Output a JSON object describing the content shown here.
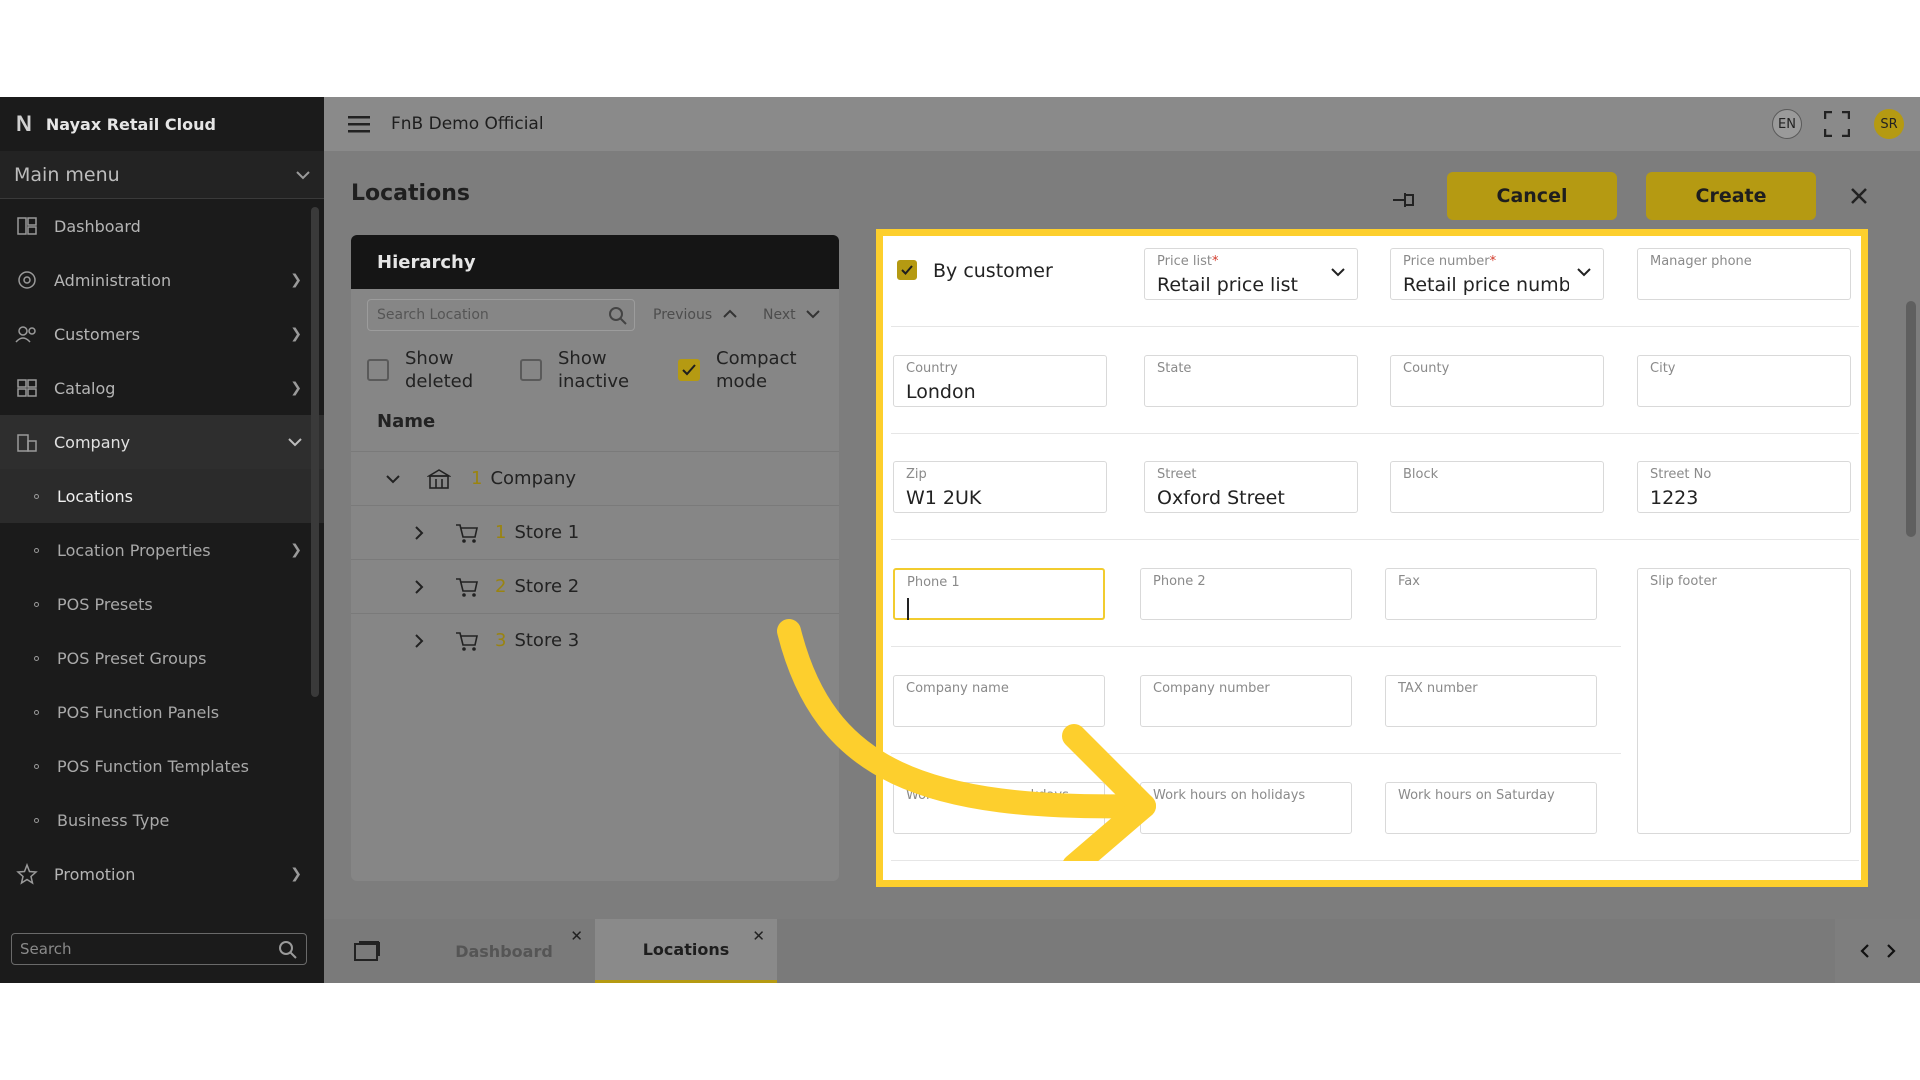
{
  "sidebar": {
    "brand": "Nayax Retail Cloud",
    "main_menu": "Main menu",
    "items": [
      {
        "label": "Dashboard",
        "icon": "dashboard-icon"
      },
      {
        "label": "Administration",
        "icon": "gear-icon"
      },
      {
        "label": "Customers",
        "icon": "users-icon"
      },
      {
        "label": "Catalog",
        "icon": "grid-icon"
      },
      {
        "label": "Company",
        "icon": "building-icon"
      }
    ],
    "sub_items": [
      "Locations",
      "Location Properties",
      "POS Presets",
      "POS Preset Groups",
      "POS Function Panels",
      "POS Function Templates",
      "Business Type"
    ],
    "promotion": "Promotion",
    "search_placeholder": "Search"
  },
  "topbar": {
    "company": "FnB Demo Official",
    "lang": "EN",
    "user_initials": "SR"
  },
  "page": {
    "title": "Locations",
    "cancel": "Cancel",
    "create": "Create"
  },
  "hierarchy": {
    "title": "Hierarchy",
    "search_placeholder": "Search Location",
    "previous": "Previous",
    "next": "Next",
    "show_deleted": "Show deleted",
    "show_inactive": "Show inactive",
    "compact_mode": "Compact mode",
    "name_header": "Name",
    "rows": [
      {
        "num": "1",
        "label": "Company"
      },
      {
        "num": "1",
        "label": "Store 1"
      },
      {
        "num": "2",
        "label": "Store 2"
      },
      {
        "num": "3",
        "label": "Store 3"
      }
    ]
  },
  "form": {
    "by_customer": "By customer",
    "price_list_label": "Price list",
    "price_list_value": "Retail price list",
    "price_number_label": "Price number",
    "price_number_value": "Retail price number",
    "manager_phone": "Manager phone",
    "country_label": "Country",
    "country_value": "London",
    "state": "State",
    "county": "County",
    "city": "City",
    "zip_label": "Zip",
    "zip_value": "W1 2UK",
    "street_label": "Street",
    "street_value": "Oxford Street",
    "block": "Block",
    "street_no_label": "Street No",
    "street_no_value": "1223",
    "phone1": "Phone 1",
    "phone2": "Phone 2",
    "fax": "Fax",
    "slip_footer": "Slip footer",
    "company_name": "Company name",
    "company_number": "Company number",
    "tax_number": "TAX number",
    "work_weekdays": "Work hours on weekdays",
    "work_holidays": "Work hours on holidays",
    "work_saturday": "Work hours on Saturday"
  },
  "tabs": [
    {
      "label": "Dashboard"
    },
    {
      "label": "Locations"
    }
  ],
  "colors": {
    "accent": "#b59a12",
    "highlight": "#fdcf2d",
    "arrow": "#fdcf2d"
  }
}
